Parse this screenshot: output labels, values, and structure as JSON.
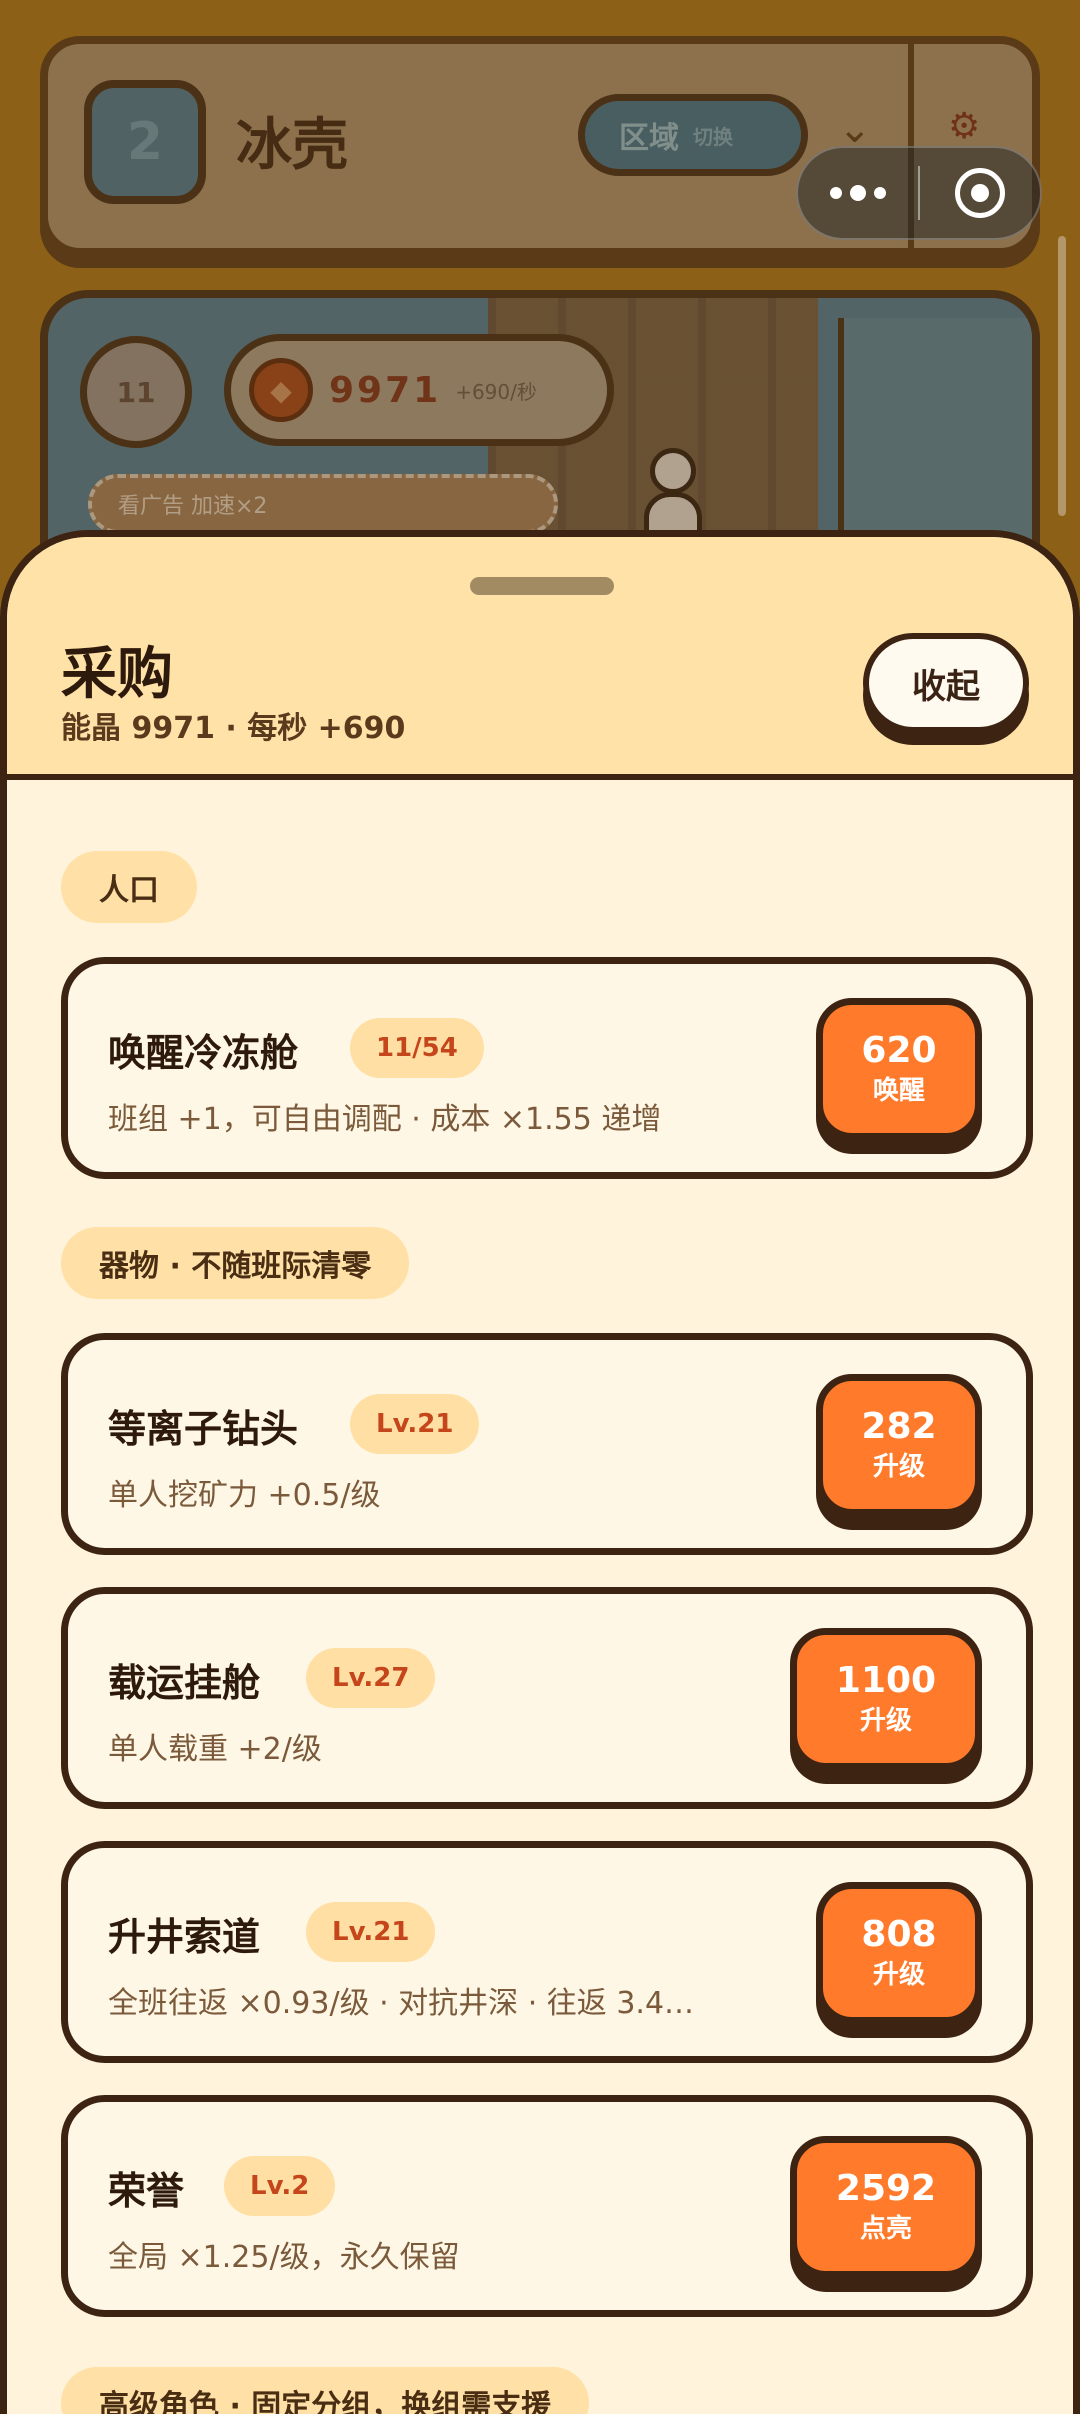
{
  "background": {
    "region_number": "2",
    "region_name": "冰壳",
    "region_pill_label": "区域",
    "region_pill_sub": "切换",
    "level_text": "11",
    "coin_value": "9971",
    "coin_rate": "+690/秒",
    "ad_text": "看广告 加速×2"
  },
  "sheet": {
    "title": "采购",
    "subtitle": "能晶 9971 · 每秒 +690",
    "collapse_label": "收起"
  },
  "sections": {
    "population": "人口",
    "equipment": "器物 · 不随班际清零",
    "advanced": "高级角色 · 固定分组，换组需支援"
  },
  "items": [
    {
      "name": "唤醒冷冻舱",
      "badge": "11/54",
      "desc": "班组 +1，可自由调配 · 成本 ×1.55 递增",
      "cost": "620",
      "action": "唤醒"
    },
    {
      "name": "等离子钻头",
      "badge": "Lv.21",
      "desc": "单人挖矿力 +0.5/级",
      "cost": "282",
      "action": "升级"
    },
    {
      "name": "载运挂舱",
      "badge": "Lv.27",
      "desc": "单人载重 +2/级",
      "cost": "1100",
      "action": "升级"
    },
    {
      "name": "升井索道",
      "badge": "Lv.21",
      "desc": "全班往返 ×0.93/级 · 对抗井深 · 往返 3.4…",
      "cost": "808",
      "action": "升级"
    },
    {
      "name": "荣誉",
      "badge": "Lv.2",
      "desc": "全局 ×1.25/级，永久保留",
      "cost": "2592",
      "action": "点亮"
    }
  ],
  "colors": {
    "accent_orange": "#ff7a2a",
    "header_bg": "#ffe2a8",
    "outline": "#3d2412"
  }
}
